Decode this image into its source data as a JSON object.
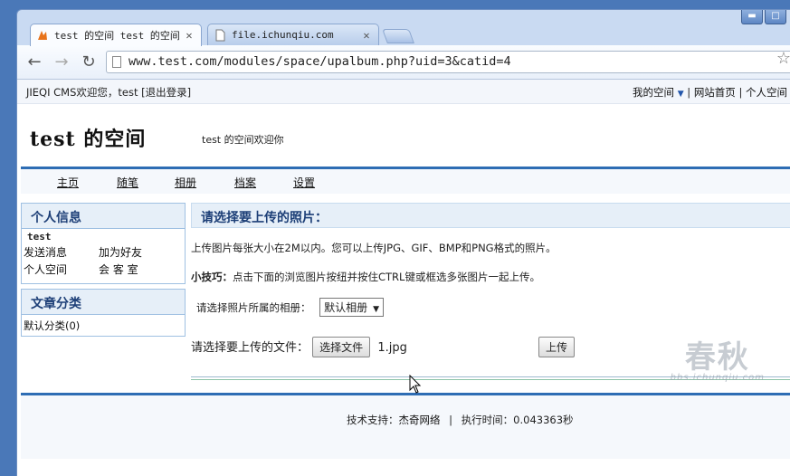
{
  "browser": {
    "tabs": [
      {
        "title": "test 的空间 test 的空间",
        "icon": "site-logo-icon",
        "active": true
      },
      {
        "title": "file.ichunqiu.com",
        "icon": "page-icon",
        "active": false
      }
    ],
    "url": "www.test.com/modules/space/upalbum.php?uid=3&catid=4",
    "window_controls": [
      "minimize-icon",
      "maximize-icon"
    ]
  },
  "topbar": {
    "welcome_prefix": "JIEQI CMS欢迎您，test ",
    "logout": "[退出登录]",
    "my_space": "我的空间",
    "sep": "|",
    "home": "网站首页",
    "personal_space": "个人空间"
  },
  "header": {
    "title": "test 的空间",
    "welcome": "test 的空间欢迎你"
  },
  "nav": [
    "主页",
    "随笔",
    "相册",
    "档案",
    "设置"
  ],
  "sidebar": {
    "personal": {
      "title": "个人信息",
      "username": "test",
      "links": [
        "发送消息",
        "加为好友",
        "个人空间",
        "会 客 室"
      ]
    },
    "category": {
      "title": "文章分类",
      "items": [
        "默认分类(0)"
      ]
    }
  },
  "main": {
    "title": "请选择要上传的照片：",
    "desc": "上传图片每张大小在2M以内。您可以上传JPG、GIF、BMP和PNG格式的照片。",
    "tip_label": "小技巧：",
    "tip_text": "点击下面的浏览图片按纽并按住CTRL键或框选多张图片一起上传。",
    "album_label": "请选择照片所属的相册：",
    "album_selected": "默认相册",
    "file_label": "请选择要上传的文件：",
    "choose_button": "选择文件",
    "file_name": "1.jpg",
    "upload_button": "上传"
  },
  "footer": {
    "support_label": "技术支持：",
    "support_link": "杰奇网络",
    "time_label": "执行时间：0.043363秒"
  },
  "watermark": {
    "main": "春秋",
    "sub": "bbs.ichunqiu.com"
  },
  "colors": {
    "accent": "#2e6db4",
    "header_bg": "#e6eff8",
    "heading_text": "#1d3f77"
  }
}
